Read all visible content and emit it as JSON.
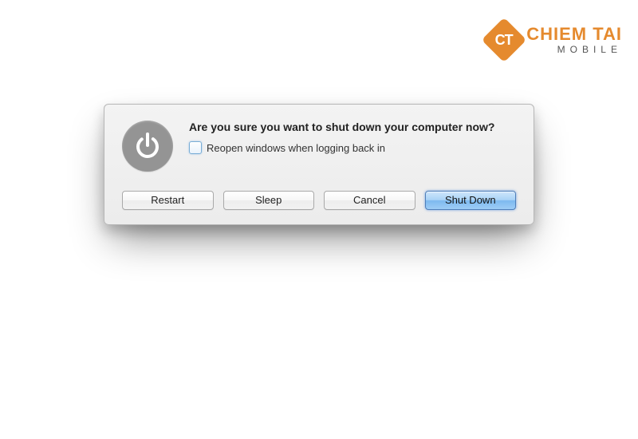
{
  "watermark": {
    "logo_letters": "CT",
    "brand": "CHIEM TAI",
    "subbrand": "MOBILE"
  },
  "dialog": {
    "title": "Are you sure you want to shut down your computer now?",
    "checkbox_label": "Reopen windows when logging back in",
    "checkbox_checked": false,
    "buttons": {
      "restart": "Restart",
      "sleep": "Sleep",
      "cancel": "Cancel",
      "shutdown": "Shut Down"
    }
  }
}
